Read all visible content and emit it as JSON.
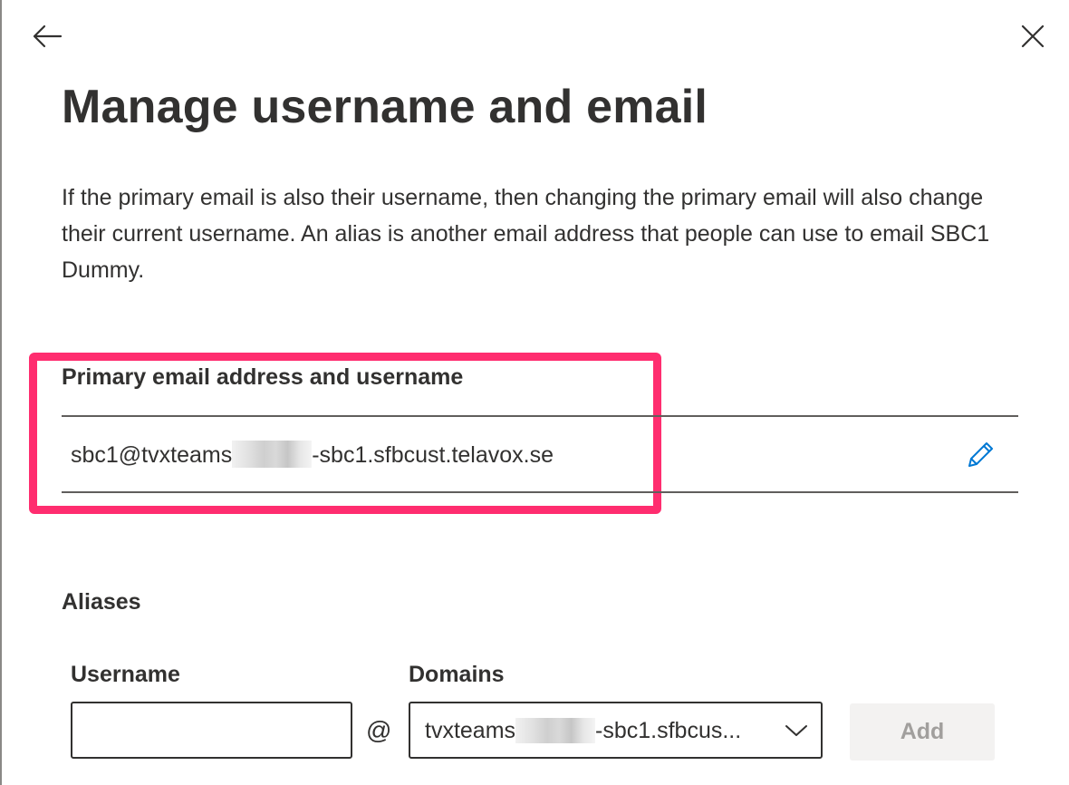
{
  "header": {
    "back_icon": "arrow-left-icon",
    "close_icon": "close-icon",
    "title": "Manage username and email"
  },
  "description": "If the primary email is also their username, then changing the primary email will also change their current username. An alias is another email address that people can use to email SBC1 Dummy.",
  "primary": {
    "label": "Primary email address and username",
    "email_prefix": "sbc1@tvxteams",
    "email_suffix": "-sbc1.sfbcust.telavox.se",
    "edit_icon": "pencil-icon"
  },
  "aliases": {
    "label": "Aliases",
    "username_label": "Username",
    "username_value": "",
    "at_symbol": "@",
    "domains_label": "Domains",
    "domain_prefix": "tvxteams",
    "domain_suffix": "-sbc1.sfbcus...",
    "chevron_icon": "chevron-down-icon",
    "add_label": "Add"
  },
  "colors": {
    "highlight": "#ff2d6f",
    "edit_icon": "#0078d4",
    "disabled_text": "#a19f9d"
  }
}
